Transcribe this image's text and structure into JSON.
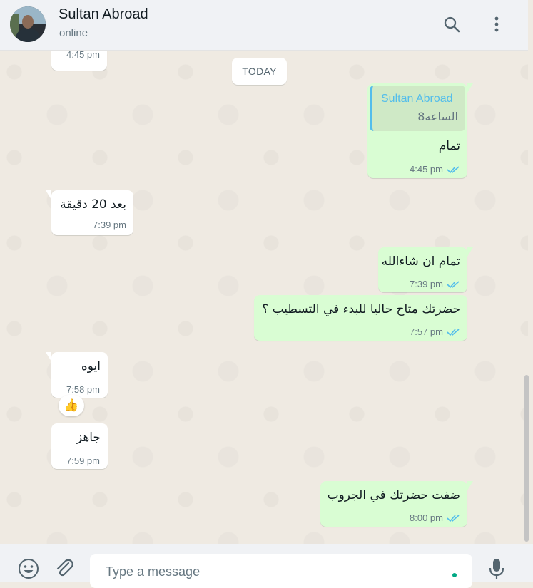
{
  "header": {
    "contact_name": "Sultan Abroad",
    "status": "online",
    "icons": [
      "search-icon",
      "menu-icon"
    ]
  },
  "chat": {
    "date_label": "TODAY",
    "messages": [
      {
        "direction": "in",
        "text": "",
        "time": "4:45 pm"
      },
      {
        "direction": "out",
        "quoted_author": "Sultan Abroad",
        "quoted_text": "الساعه8",
        "text": "تمام",
        "time": "4:45 pm",
        "status": "read"
      },
      {
        "direction": "in",
        "text": "بعد 20 دقيقة",
        "time": "7:39 pm"
      },
      {
        "direction": "out",
        "text": "تمام ان شاءالله",
        "time": "7:39 pm",
        "status": "read"
      },
      {
        "direction": "out",
        "text": "حضرتك متاح حاليا للبدء في التسطيب ؟",
        "time": "7:57 pm",
        "status": "read"
      },
      {
        "direction": "in",
        "text": "ايوه",
        "time": "7:58 pm",
        "reaction": "👍"
      },
      {
        "direction": "in",
        "text": "جاهز",
        "time": "7:59 pm"
      },
      {
        "direction": "out",
        "text": "ضفت حضرتك في الجروب",
        "time": "8:00 pm",
        "status": "read"
      }
    ]
  },
  "composer": {
    "placeholder": "Type a message",
    "icons": [
      "emoji-icon",
      "attach-icon",
      "mic-icon"
    ]
  },
  "colors": {
    "incoming_bg": "#ffffff",
    "outgoing_bg": "#d9fdd3",
    "read_tick": "#53bdeb",
    "chat_bg": "#efeae2"
  }
}
